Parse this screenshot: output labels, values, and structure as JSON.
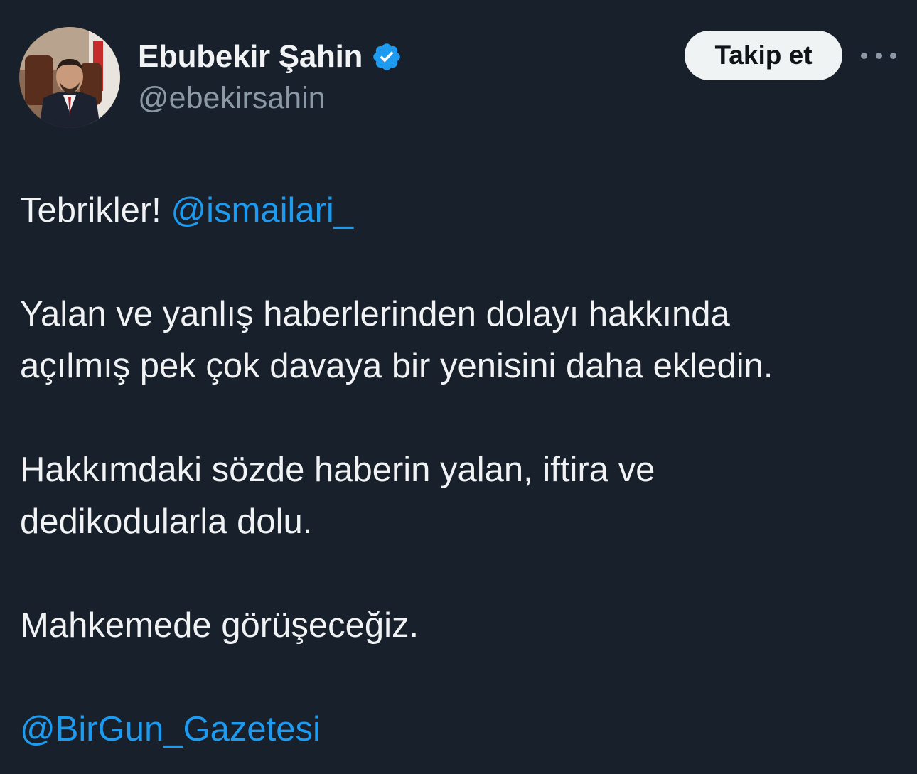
{
  "author": {
    "display_name": "Ebubekir Şahin",
    "handle": "@ebekirsahin",
    "verified_icon": "verified-badge-icon",
    "avatar_alt": "profile photo"
  },
  "actions": {
    "follow_label": "Takip et",
    "more_icon": "more-options-icon"
  },
  "tweet": {
    "line1_text": "Tebrikler! ",
    "line1_mention": "@ismailari_",
    "para2_line1": "Yalan ve yanlış haberlerinden dolayı hakkında",
    "para2_line2": "açılmış pek çok davaya bir yenisini daha ekledin.",
    "para3_line1": "Hakkımdaki sözde haberin yalan, iftira ve",
    "para3_line2": "dedikodularla dolu.",
    "para4": "Mahkemede görüşeceğiz.",
    "final_mention": "@BirGun_Gazetesi"
  },
  "colors": {
    "background": "#17202b",
    "text": "#e7e9ea",
    "secondary": "#8b98a5",
    "link": "#1d9bf0",
    "verified": "#1d9bf0",
    "button_bg": "#eff3f4"
  }
}
